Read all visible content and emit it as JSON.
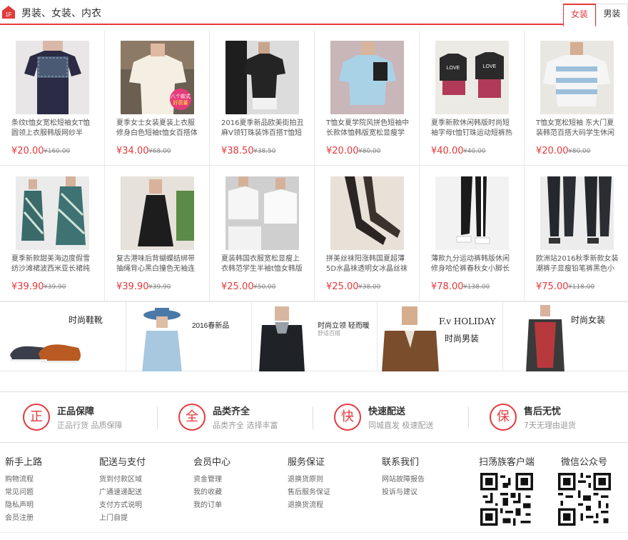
{
  "floor": {
    "badge": "1F",
    "title": "男装、女装、内衣",
    "tabs": [
      {
        "label": "女装",
        "active": true
      },
      {
        "label": "男装",
        "active": false
      }
    ]
  },
  "products": [
    {
      "name": "条纹t恤女宽松短袖女T恤圆领上衣服韩版网纱半",
      "price": "¥20.00",
      "old": "¥160.00"
    },
    {
      "name": "夏季女士女装夏装上衣服修身白色短袖t恤女百搭体",
      "price": "¥34.00",
      "old": "¥68.00",
      "badge": "八个款式好质量"
    },
    {
      "name": "2016夏季新品欧美街拍丑麻V领钉珠装饰百搭T恤短",
      "price": "¥38.50",
      "old": "¥38.50"
    },
    {
      "name": "T恤女夏学院风拼色短袖中长款体恤韩版宽松显瘦学",
      "price": "¥20.00",
      "old": "¥80.00"
    },
    {
      "name": "夏季新款休闲韩版时尚短袖字母t恤钉珠运动短裤热",
      "price": "¥40.00",
      "old": "¥40.00"
    },
    {
      "name": "T恤女宽松短袖 东大门夏装韩范百搭大码学生休闲",
      "price": "¥20.00",
      "old": "¥80.00"
    },
    {
      "name": "夏季新款甜美海边度假雪纺沙滩裙波西米亚长裙纯",
      "price": "¥39.90",
      "old": "¥39.90"
    },
    {
      "name": "复古港味后背蝴蝶结绑带抽绳背心黑白撞色无袖连",
      "price": "¥39.90",
      "old": "¥39.90"
    },
    {
      "name": "夏装韩国衣服宽松显瘦上衣韩范学生半袖t恤女韩版",
      "price": "¥25.00",
      "old": "¥50.00"
    },
    {
      "name": "拼美丝袜阳涨韩国夏超薄5D水晶袜透明女冰晶丝袜",
      "price": "¥25.00",
      "old": "¥38.00"
    },
    {
      "name": "薄款九分运动裤韩版休闲修身哈伦裤春秋女小脚长",
      "price": "¥78.00",
      "old": "¥138.00"
    },
    {
      "name": "欧洲站2016秋季新款女装潮裤子显瘦铅笔裤黑色小",
      "price": "¥75.00",
      "old": "¥118.00"
    }
  ],
  "banners": [
    {
      "title": "时尚鞋靴"
    },
    {
      "title": "2016春新品"
    },
    {
      "title": "时尚立领 轻而暖",
      "sub": "舒适百搭"
    },
    {
      "title": "F.v HOLIDAY",
      "sub": "时尚男装"
    },
    {
      "title": "时尚女装"
    }
  ],
  "services": [
    {
      "icon": "正",
      "title": "正品保障",
      "sub": "正品行货 品质保障"
    },
    {
      "icon": "全",
      "title": "品类齐全",
      "sub": "品类齐全 选择丰富"
    },
    {
      "icon": "快",
      "title": "快速配送",
      "sub": "同城直发 极速配送"
    },
    {
      "icon": "保",
      "title": "售后无忧",
      "sub": "7天无理由退货"
    }
  ],
  "footer": {
    "cols": [
      {
        "title": "新手上路",
        "links": [
          "购物流程",
          "常见问题",
          "隐私声明",
          "会员注册"
        ]
      },
      {
        "title": "配送与支付",
        "links": [
          "货到付款区域",
          "广通速递配送",
          "支付方式说明",
          "上门自提"
        ]
      },
      {
        "title": "会员中心",
        "links": [
          "资金管理",
          "我的收藏",
          "我的订单"
        ]
      },
      {
        "title": "服务保证",
        "links": [
          "退换货原则",
          "售后服务保证",
          "退换货流程"
        ]
      },
      {
        "title": "联系我们",
        "links": [
          "网站故障报告",
          "投诉与建议"
        ]
      }
    ],
    "qr": [
      {
        "title": "扫荡族客户端"
      },
      {
        "title": "微信公众号"
      }
    ]
  },
  "colors": {
    "accent": "#e4393c"
  }
}
